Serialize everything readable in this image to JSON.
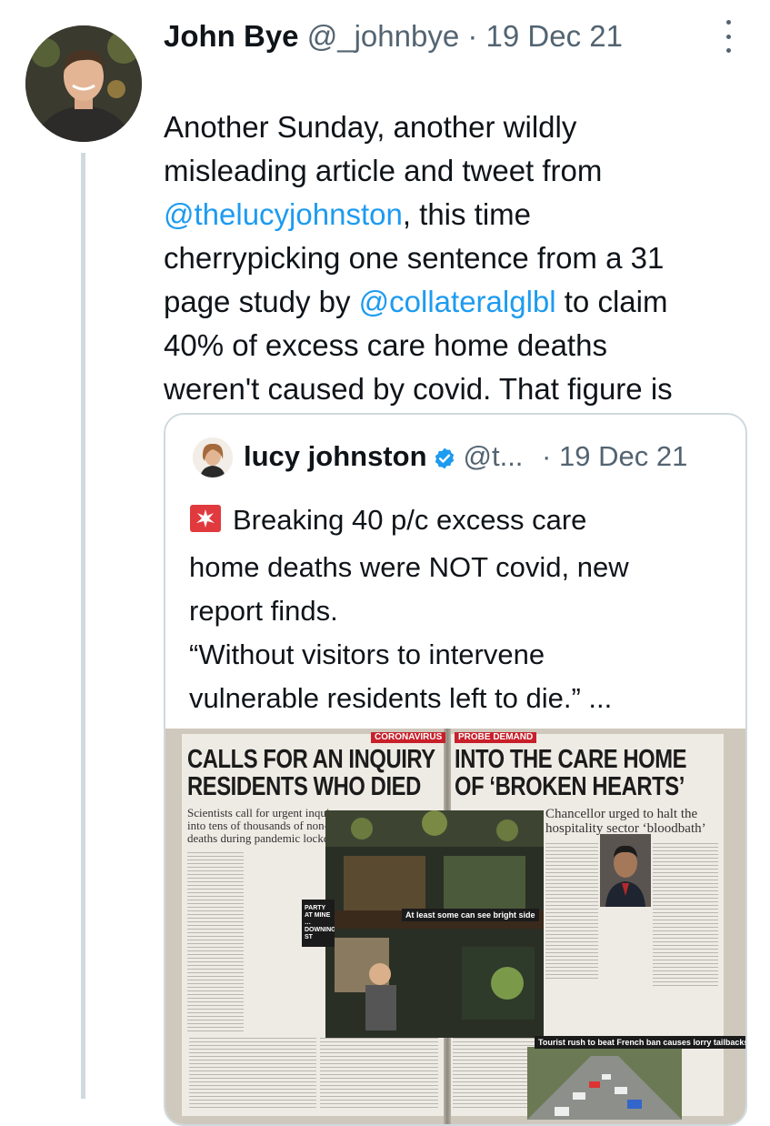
{
  "tweet": {
    "author_name": "John Bye",
    "handle": "@_johnbye",
    "separator": "·",
    "date": "19 Dec 21",
    "text_parts": [
      {
        "text": "Another Sunday, another wildly\nmisleading article and tweet from\n",
        "mention": false
      },
      {
        "text": "@thelucyjohnston",
        "mention": true
      },
      {
        "text": ", this time\ncherrypicking one sentence from a 31\npage study by ",
        "mention": false
      },
      {
        "text": "@collateralglbl",
        "mention": true
      },
      {
        "text": " to claim\n40% of excess care home deaths\nweren't caused by covid. That figure is\nonly for the first wave, and it's wrong.",
        "mention": false
      }
    ]
  },
  "quoted_tweet": {
    "author_name": "lucy johnston",
    "handle": "@t...",
    "separator": "·",
    "date": "19 Dec 21",
    "text": "Breaking 40 p/c excess care\nhome deaths were NOT covid, new\nreport finds.\n“Without visitors to intervene\nvulnerable residents left to die.” ...",
    "icons": {
      "siren": "police-light-emoji",
      "verified": "verified-badge-icon"
    }
  },
  "newspaper": {
    "left_tag": "CORONAVIRUS",
    "right_tag": "PROBE DEMAND",
    "left_headline": [
      "CALLS FOR AN INQUIRY",
      "RESIDENTS WHO DIED"
    ],
    "right_headline": [
      "INTO THE CARE HOME",
      "OF ‘BROKEN HEARTS’"
    ],
    "left_subhead": "Scientists call for urgent inquiry\ninto tens of thousands of non-Covid\ndeaths during pandemic lockdown",
    "right_subhead": "Chancellor urged to halt the\nhospitality sector ‘bloodbath’",
    "photo_caption": "At least some can see bright side",
    "sign_text": "PARTY\nAT MINE\n…DOWNING ST",
    "bottom_caption": "Tourist rush to beat French ban causes lorry tailbacks"
  },
  "colors": {
    "mention": "#1d9bf0",
    "meta": "#536471",
    "verified": "#1d9bf0",
    "thread_line": "#cfd9de",
    "tag_red": "#c8202a"
  }
}
